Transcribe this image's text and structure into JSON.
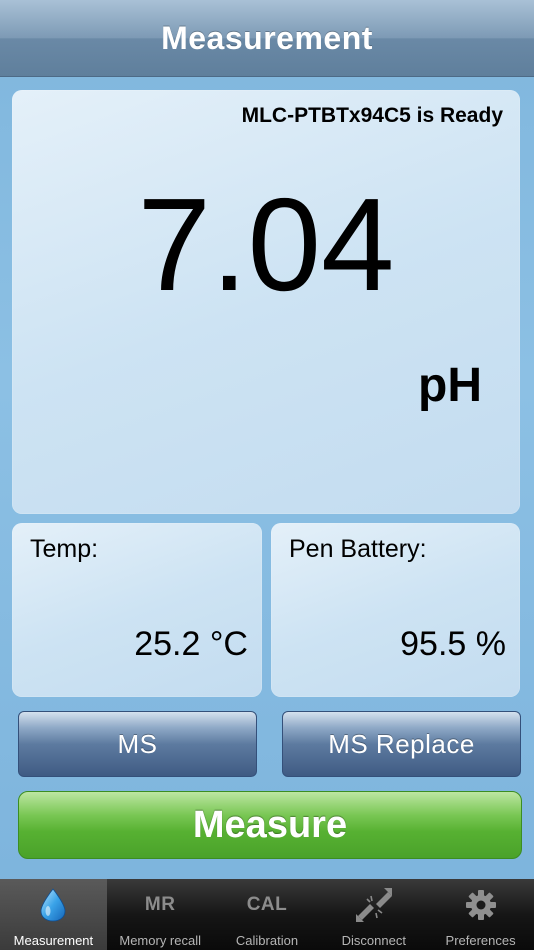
{
  "header": {
    "title": "Measurement"
  },
  "device_status": "MLC-PTBTx94C5 is Ready",
  "reading": {
    "value": "7.04",
    "unit": "pH"
  },
  "temperature": {
    "label": "Temp:",
    "value": "25.2 °C"
  },
  "battery": {
    "label": "Pen Battery:",
    "value": "95.5 %"
  },
  "buttons": {
    "ms": "MS",
    "ms_replace": "MS Replace",
    "measure": "Measure"
  },
  "tabs": [
    {
      "label": "Measurement",
      "icon": "water-drop-icon",
      "active": true
    },
    {
      "label": "Memory recall",
      "icon_text": "MR"
    },
    {
      "label": "Calibration",
      "icon_text": "CAL"
    },
    {
      "label": "Disconnect",
      "icon": "disconnect-icon"
    },
    {
      "label": "Preferences",
      "icon": "gear-icon"
    }
  ],
  "colors": {
    "measure_button": "#57b132",
    "header": "#6a89a6",
    "tabbar": "#161616"
  }
}
